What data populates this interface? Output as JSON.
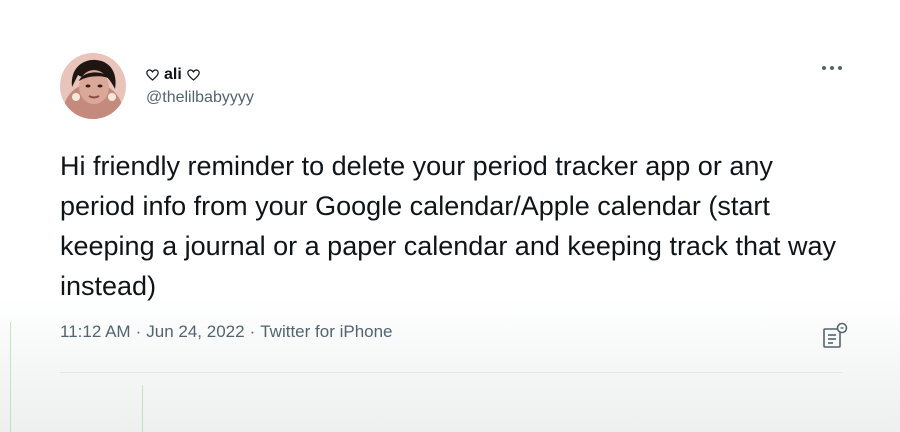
{
  "author": {
    "display_name": "ali",
    "handle": "@thelilbabyyyy",
    "avatar_icon": "profile-photo",
    "name_decoration_icon": "heart-outline-icon"
  },
  "tweet": {
    "text": "Hi friendly reminder to delete your period tracker app or any period info from your Google calendar/Apple calendar (start keeping a journal or a paper calendar and keeping track that way instead)",
    "time": "11:12 AM",
    "separator": "·",
    "date": "Jun 24, 2022",
    "source": "Twitter for iPhone"
  },
  "icons": {
    "more": "more-horizontal-icon",
    "analytics": "view-analytics-icon"
  },
  "colors": {
    "text_primary": "#0f1419",
    "text_secondary": "#536471",
    "divider": "#e3e6e8"
  }
}
